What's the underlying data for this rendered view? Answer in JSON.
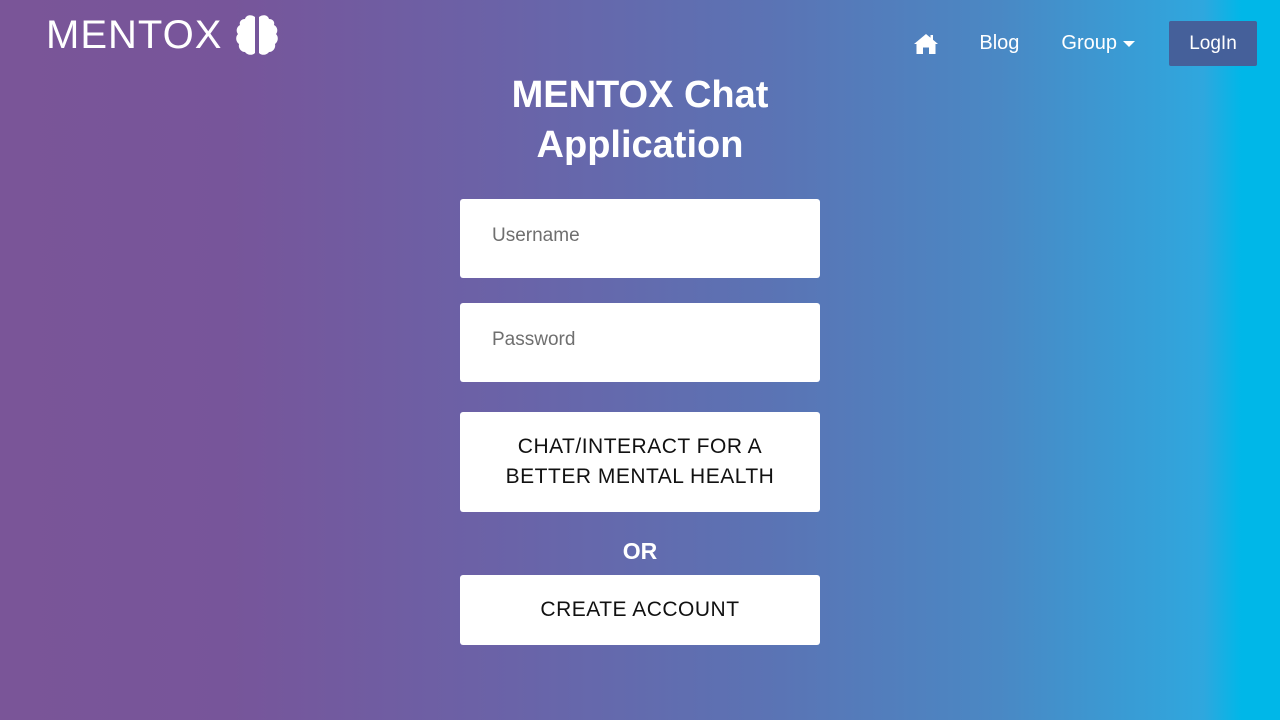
{
  "header": {
    "logo_text": "MENTOX",
    "logo_icon": "brain-icon",
    "nav": {
      "home_icon": "home-icon",
      "blog_label": "Blog",
      "group_label": "Group",
      "group_icon": "caret-down-icon",
      "login_label": "LogIn"
    }
  },
  "main": {
    "title_line1": "MENTOX Chat",
    "title_line2": "Application",
    "username_placeholder": "Username",
    "password_placeholder": "Password",
    "chat_button_label": "CHAT/INTERACT FOR A BETTER MENTAL HEALTH",
    "or_label": "OR",
    "create_account_label": "CREATE ACCOUNT"
  },
  "colors": {
    "gradient_start": "#7a5598",
    "gradient_end": "#00b7e8",
    "login_button_bg": "#45609a",
    "text_primary": "#ffffff",
    "button_bg": "#ffffff",
    "button_text": "#111111"
  }
}
